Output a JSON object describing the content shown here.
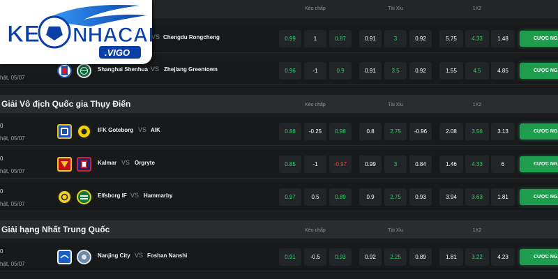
{
  "brand": {
    "name": "KEONHACAI",
    "suffix": ".VIGO"
  },
  "columns": {
    "handicap": "Kèo chấp",
    "overunder": "Tài Xỉu",
    "x12": "1X2"
  },
  "bet_label": "CƯỢC NGAY",
  "leagues": [
    {
      "title": "",
      "matches": [
        {
          "date": "",
          "home": "",
          "away": "Chengdu Rongcheng",
          "vs": "VS",
          "h": [
            "0.99",
            "1",
            "0.87"
          ],
          "ou": [
            "0.91",
            "3",
            "0.92"
          ],
          "x12": [
            "5.75",
            "4.33",
            "1.48"
          ]
        },
        {
          "date": "hật, 05/07",
          "home": "Shanghai Shenhua",
          "away": "Zhejiang Greentown",
          "vs": "VS",
          "h": [
            "0.96",
            "-1",
            "0.9"
          ],
          "ou": [
            "0.91",
            "3.5",
            "0.92"
          ],
          "x12": [
            "1.55",
            "4.5",
            "4.85"
          ]
        }
      ]
    },
    {
      "title": "Giải Vô địch Quốc gia Thụy Điển",
      "matches": [
        {
          "time": "0",
          "date": "hật, 05/07",
          "home": "IFK Goteborg",
          "away": "AIK",
          "vs": "VS",
          "h": [
            "0.88",
            "-0.25",
            "0.98"
          ],
          "ou": [
            "0.8",
            "2.75",
            "-0.96"
          ],
          "x12": [
            "2.08",
            "3.56",
            "3.13"
          ]
        },
        {
          "time": "0",
          "date": "hật, 05/07",
          "home": "Kalmar",
          "away": "Orgryte",
          "vs": "VS",
          "h": [
            "0.85",
            "-1",
            "-0.97"
          ],
          "ou": [
            "0.99",
            "3",
            "0.84"
          ],
          "x12": [
            "1.46",
            "4.33",
            "6"
          ]
        },
        {
          "time": "0",
          "date": "hật, 05/07",
          "home": "Elfsborg IF",
          "away": "Hammarby",
          "vs": "VS",
          "h": [
            "0.97",
            "0.5",
            "0.89"
          ],
          "ou": [
            "0.9",
            "2.75",
            "0.93"
          ],
          "x12": [
            "3.94",
            "3.63",
            "1.81"
          ]
        }
      ]
    },
    {
      "title": "Giải hạng Nhất Trung Quốc",
      "matches": [
        {
          "time": "0",
          "date": "hật, 05/07",
          "home": "Nanjing City",
          "away": "Foshan Nanshi",
          "vs": "VS",
          "h": [
            "0.91",
            "-0.5",
            "0.93"
          ],
          "ou": [
            "0.92",
            "2.25",
            "0.89"
          ],
          "x12": [
            "1.81",
            "3.22",
            "4.23"
          ]
        }
      ]
    }
  ]
}
